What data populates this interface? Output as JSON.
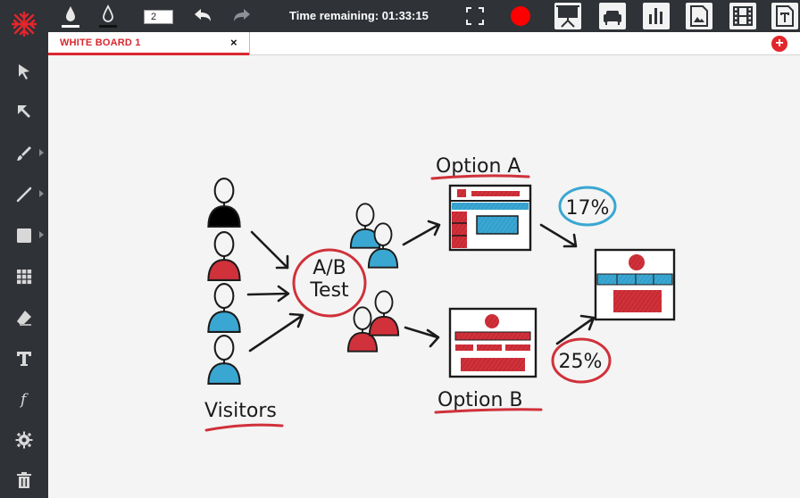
{
  "toolbar": {
    "brush_size": "2",
    "timer_text": "Time remaining: 01:33:15",
    "record_color": "#ff0000"
  },
  "tab": {
    "title": "WHITE BOARD 1",
    "close_label": "×",
    "add_label": "+"
  },
  "sidebar": {
    "tools": [
      {
        "name": "select-arrow-icon"
      },
      {
        "name": "pointer-arrow-icon"
      },
      {
        "name": "brush-icon"
      },
      {
        "name": "line-icon"
      },
      {
        "name": "shape-icon"
      },
      {
        "name": "grid-icon"
      },
      {
        "name": "eraser-icon"
      },
      {
        "name": "text-icon"
      },
      {
        "name": "formula-icon"
      },
      {
        "name": "settings-gear-icon"
      },
      {
        "name": "trash-icon"
      }
    ]
  },
  "drawing": {
    "label_visitors": "Visitors",
    "label_ab_line1": "A/B",
    "label_ab_line2": "Test",
    "label_option_a": "Option A",
    "label_option_b": "Option B",
    "percent_a": "17%",
    "percent_b": "25%"
  },
  "colors": {
    "accent_red": "#d9282f",
    "blue": "#3aa7d2",
    "red": "#d0313a",
    "dark": "#2f3237"
  }
}
